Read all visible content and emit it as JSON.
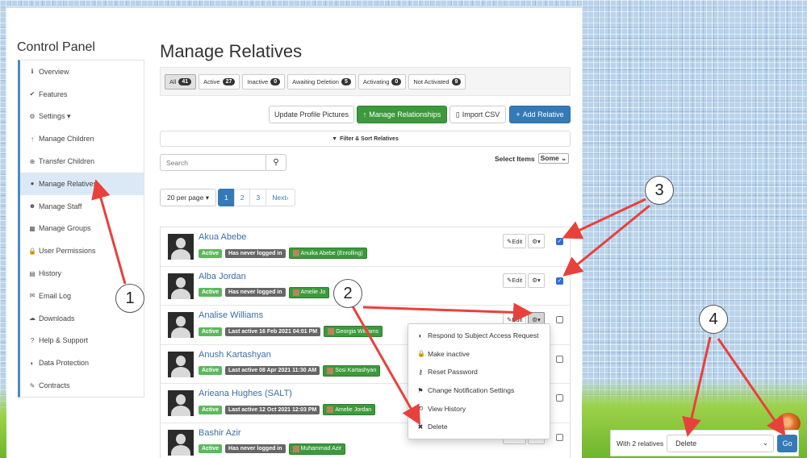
{
  "sidebar": {
    "title": "Control Panel",
    "items": [
      {
        "label": "Overview",
        "icon": "ℹ"
      },
      {
        "label": "Features",
        "icon": "✔"
      },
      {
        "label": "Settings ▾",
        "icon": "⚙"
      },
      {
        "label": "Manage Children",
        "icon": "↑"
      },
      {
        "label": "Transfer Children",
        "icon": "⊕"
      },
      {
        "label": "Manage Relatives",
        "icon": "●"
      },
      {
        "label": "Manage Staff",
        "icon": "☻"
      },
      {
        "label": "Manage Groups",
        "icon": "▦"
      },
      {
        "label": "User Permissions",
        "icon": "🔒"
      },
      {
        "label": "History",
        "icon": "▤"
      },
      {
        "label": "Email Log",
        "icon": "✉"
      },
      {
        "label": "Downloads",
        "icon": "☁"
      },
      {
        "label": "Help & Support",
        "icon": "?"
      },
      {
        "label": "Data Protection",
        "icon": "◐"
      },
      {
        "label": "Contracts",
        "icon": "✎"
      }
    ]
  },
  "main": {
    "title": "Manage Relatives",
    "filters": [
      {
        "label": "All",
        "count": "41"
      },
      {
        "label": "Active",
        "count": "27"
      },
      {
        "label": "Inactive",
        "count": "0"
      },
      {
        "label": "Awaiting Deletion",
        "count": "5"
      },
      {
        "label": "Activating",
        "count": "0"
      },
      {
        "label": "Not Activated",
        "count": "9"
      }
    ],
    "actions": {
      "update_pictures": "Update Profile Pictures",
      "manage_relationships": "Manage Relationships",
      "import_csv": "Import CSV",
      "add_relative": "Add Relative"
    },
    "filter_sort": "Filter & Sort Relatives",
    "search_placeholder": "Search",
    "select_items_label": "Select Items",
    "select_items_value": "Some",
    "per_page": "20 per page",
    "pages": [
      "1",
      "2",
      "3"
    ],
    "next": "Next"
  },
  "relatives": [
    {
      "name": "Akua Abebe",
      "status": "Active",
      "login": "Has never logged in",
      "child": "Anuika Abebe (Enrolling)",
      "edit": "Edit",
      "checked": true
    },
    {
      "name": "Alba Jordan",
      "status": "Active",
      "login": "Has never logged in",
      "child": "Amelie Jo",
      "edit": "Edit",
      "checked": true
    },
    {
      "name": "Analise Williams",
      "status": "Active",
      "login": "Last active 16 Feb 2021 04:01 PM",
      "child": "Georgia Williams",
      "edit": "Edit",
      "checked": false
    },
    {
      "name": "Anush Kartashyan",
      "status": "Active",
      "login": "Last active 08 Apr 2021 11:30 AM",
      "child": "Sosi Kartashyan",
      "edit": "Edit",
      "checked": false
    },
    {
      "name": "Arieana Hughes (SALT)",
      "status": "Active",
      "login": "Last active 12 Oct 2021 12:03 PM",
      "child": "Amelie Jordan",
      "edit": "Edit",
      "checked": false
    },
    {
      "name": "Bashir Azir",
      "status": "Active",
      "login": "Has never logged in",
      "child": "Muhammad Azir",
      "edit": "Edit",
      "checked": false
    }
  ],
  "dropdown_menu": [
    {
      "label": "Respond to Subject Access Request",
      "icon": "◐"
    },
    {
      "label": "Make inactive",
      "icon": "🔒"
    },
    {
      "label": "Reset Password",
      "icon": "⚷"
    },
    {
      "label": "Change Notification Settings",
      "icon": "⚑"
    },
    {
      "label": "View History",
      "icon": "⟲"
    },
    {
      "label": "Delete",
      "icon": "✖"
    }
  ],
  "bulk": {
    "label": "With 2 relatives",
    "selected_action": "Delete",
    "go": "Go"
  },
  "callouts": [
    "1",
    "2",
    "3",
    "4"
  ],
  "colors": {
    "primary": "#337ab7",
    "success": "#5cb85c",
    "green_button": "#3c9a3c",
    "arrow": "#e8413c"
  }
}
